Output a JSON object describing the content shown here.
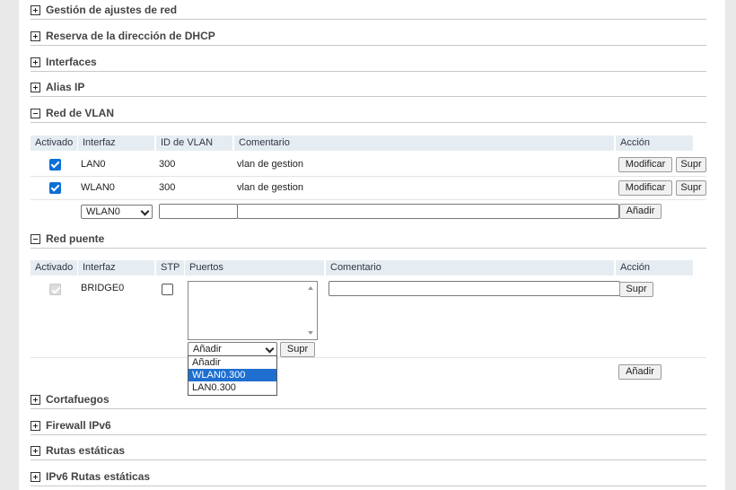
{
  "sections": {
    "s1": {
      "title": "Gestión de ajustes de red",
      "toggle": "plus-icon"
    },
    "s2": {
      "title": "Reserva de la dirección de DHCP",
      "toggle": "plus-icon"
    },
    "s3": {
      "title": "Interfaces",
      "toggle": "plus-icon"
    },
    "s4": {
      "title": "Alias IP",
      "toggle": "plus-icon"
    },
    "s5": {
      "title": "Red de VLAN",
      "toggle": "minus-icon"
    },
    "s6": {
      "title": "Red puente",
      "toggle": "minus-icon"
    },
    "s7": {
      "title": "Cortafuegos",
      "toggle": "plus-icon"
    },
    "s8": {
      "title": "Firewall IPv6",
      "toggle": "plus-icon"
    },
    "s9": {
      "title": "Rutas estáticas",
      "toggle": "plus-icon"
    },
    "s10": {
      "title": "IPv6 Rutas estáticas",
      "toggle": "plus-icon"
    }
  },
  "vlan": {
    "headers": {
      "enabled": "Activado",
      "interface": "Interfaz",
      "vlan_id": "ID de VLAN",
      "comment": "Comentario",
      "action": "Acción"
    },
    "rows": [
      {
        "enabled": true,
        "interface": "LAN0",
        "vlan_id": "300",
        "comment": "vlan de gestion",
        "modify": "Modificar",
        "delete": "Supr"
      },
      {
        "enabled": true,
        "interface": "WLAN0",
        "vlan_id": "300",
        "comment": "vlan de gestion",
        "modify": "Modificar",
        "delete": "Supr"
      }
    ],
    "new_row": {
      "interface_select": "WLAN0",
      "vlan_id_value": "",
      "comment_value": "",
      "add": "Añadir"
    }
  },
  "bridge": {
    "headers": {
      "enabled": "Activado",
      "interface": "Interfaz",
      "stp": "STP",
      "ports": "Puertos",
      "comment": "Comentario",
      "action": "Acción"
    },
    "row": {
      "enabled": true,
      "enabled_disabled": true,
      "interface": "BRIDGE0",
      "stp": false,
      "comment_value": "",
      "delete": "Supr"
    },
    "port_select": "Añadir",
    "port_delete": "Supr",
    "port_options": [
      "Añadir",
      "WLAN0.300",
      "LAN0.300"
    ],
    "port_selected_index": 1,
    "add": "Añadir"
  },
  "colors": {
    "accent": "#0a6fd6",
    "header_bg": "#e6edf2",
    "highlight": "#1e6fd0"
  }
}
